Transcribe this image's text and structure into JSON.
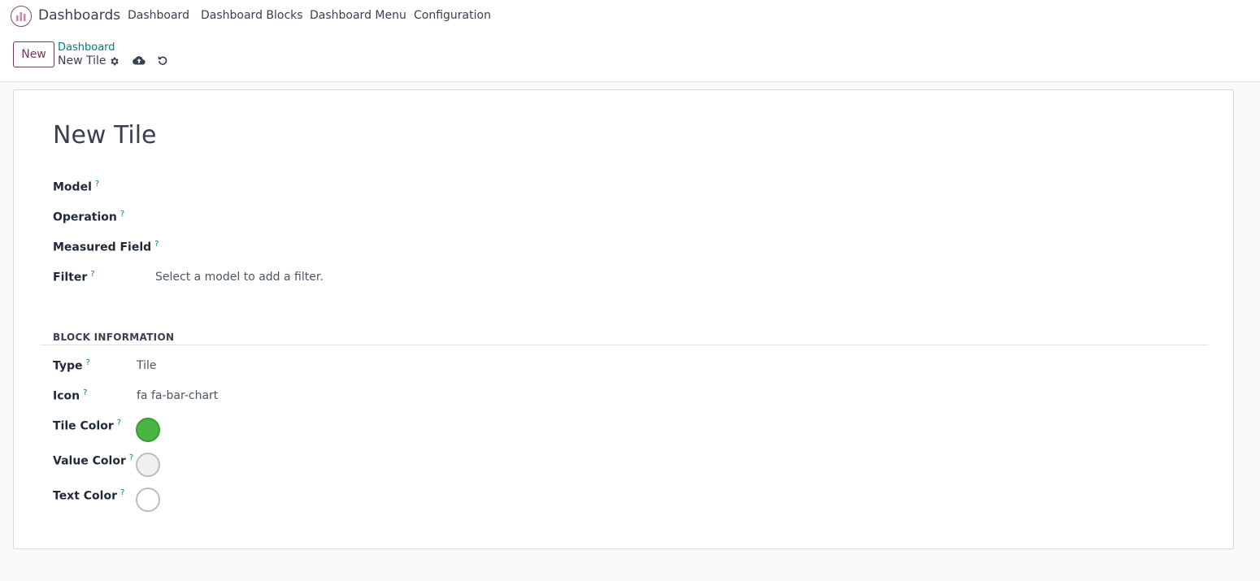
{
  "navbar": {
    "app_name": "Dashboards",
    "app_icon": "dashboards-app-icon",
    "menu": [
      "Dashboard",
      "Dashboard Blocks",
      "Dashboard Menu",
      "Configuration"
    ]
  },
  "control": {
    "new_label": "New",
    "breadcrumb_parent": "Dashboard",
    "breadcrumb_current": "New Tile",
    "icons": [
      "gear-icon",
      "cloud-upload-icon",
      "undo-icon"
    ]
  },
  "form": {
    "title": "New Tile",
    "help_marker": "?",
    "fields": {
      "model": {
        "label": "Model",
        "value": ""
      },
      "operation": {
        "label": "Operation",
        "value": ""
      },
      "measured_field": {
        "label": "Measured Field",
        "value": ""
      },
      "filter": {
        "label": "Filter",
        "value": "Select a model to add a filter."
      }
    },
    "group": {
      "title": "BLOCK INFORMATION",
      "type": {
        "label": "Type",
        "value": "Tile"
      },
      "icon": {
        "label": "Icon",
        "value": "fa fa-bar-chart"
      },
      "tile_color": {
        "label": "Tile Color",
        "color": "#4bb543"
      },
      "value_color": {
        "label": "Value Color",
        "color": "#f0f0f0"
      },
      "text_color": {
        "label": "Text Color",
        "color": "#ffffff"
      }
    }
  },
  "colors": {
    "brand": "#71395b",
    "link": "#017e84"
  }
}
